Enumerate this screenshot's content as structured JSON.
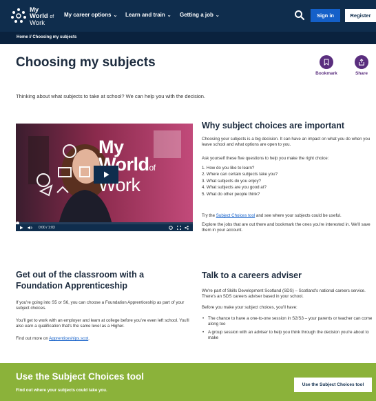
{
  "header": {
    "logo": {
      "line1": "My",
      "line2": "World",
      "line2_small": "of",
      "line3": "Work"
    },
    "nav": [
      {
        "label": "My career options",
        "chevron": "⌄"
      },
      {
        "label": "Learn and train",
        "chevron": "⌄"
      },
      {
        "label": "Getting a job",
        "chevron": "⌄"
      }
    ],
    "search_icon": "search-icon",
    "signin_label": "Sign in",
    "register_label": "Register"
  },
  "breadcrumb": "Home // Choosing my subjects",
  "page": {
    "title": "Choosing my subjects",
    "bookmark_label": "Bookmark",
    "share_label": "Share",
    "intro": "Thinking about what subjects to take at school? We can help you with the decision."
  },
  "video": {
    "overlay_line1": "My",
    "overlay_line2": "World",
    "overlay_of": "of",
    "overlay_line3": "Work",
    "time": "0:00 / 1:03",
    "progress": 0
  },
  "why": {
    "title": "Why subject choices are important",
    "p1": "Choosing your subjects is a big decision. It can have an impact on what you do when you leave school and what options are open to you.",
    "p2": "Ask yourself these five questions to help you make the right choice:",
    "questions": [
      "1.  How do you like to learn?",
      "2.  Where can certain subjects take you?",
      "3.  What subjects do you enjoy?",
      "4.  What subjects are you good at?",
      "5.  What do other people think?"
    ],
    "p3_before": "Try the ",
    "p3_link": "Subject Choices tool",
    "p3_after": " and see where your subjects could be useful.",
    "p4": "Explore the jobs that are out there and bookmark the ones you're interested in. We'll save them in your account."
  },
  "foundation": {
    "title": "Get out of the classroom with a Foundation Apprenticeship",
    "p1": "If you're going into S5 or S6, you can choose a Foundation Apprenticeship as part of your subject choices.",
    "p2": "You'll get to work with an employer and learn at college before you've even left school. You'll also earn a qualification that's the same level as a Higher.",
    "p3_before": "Find out more on ",
    "p3_link": "Apprenticeships.scot",
    "p3_after": "."
  },
  "adviser": {
    "title": "Talk to a careers adviser",
    "p1": "We're part of Skills Development Scotland (SDS) – Scotland's national careers service. There's an SDS careers adviser based in your school.",
    "p2": "Before you make your subject choices, you'll have:",
    "bullets": [
      "The chance to have a one-to-one session in S2/S3 – your parents or teacher can come along too",
      "A group session with an adviser to help you think through the decision you're about to make"
    ]
  },
  "banner": {
    "title": "Use the Subject Choices tool",
    "subtitle": "Find out where your subjects could take you.",
    "button_label": "Use the Subject Choices tool"
  },
  "colors": {
    "header_bg": "#0f2d4d",
    "signin_bg": "#1460c9",
    "accent_purple": "#5a2e7e",
    "banner_green": "#8bb23a",
    "link": "#1460c9"
  }
}
